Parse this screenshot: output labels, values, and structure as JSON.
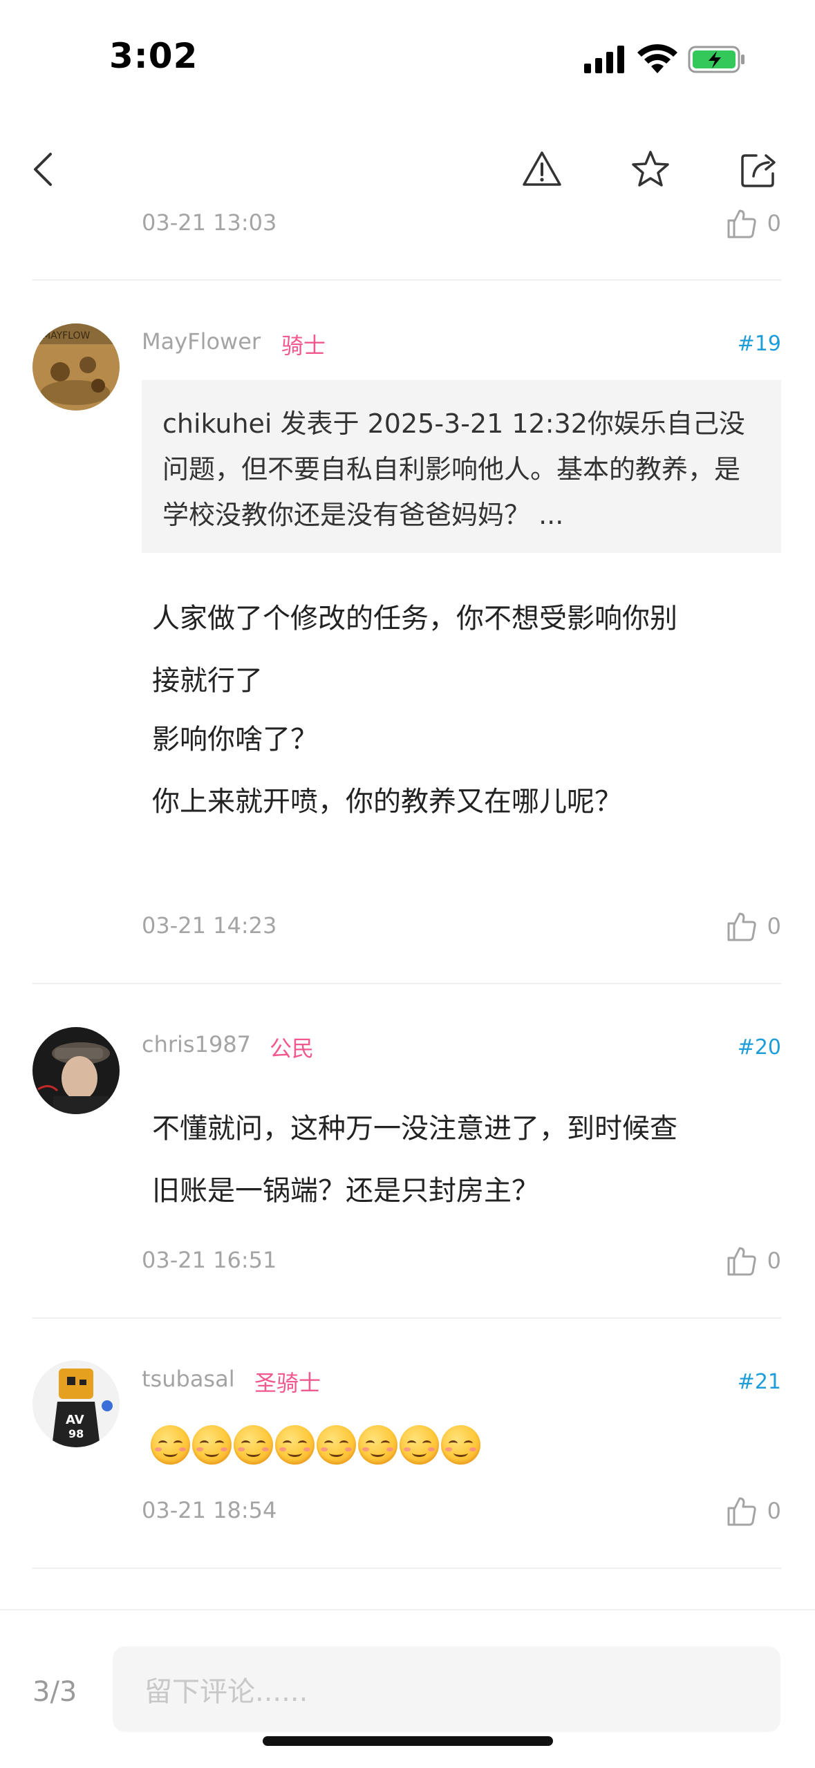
{
  "status_bar": {
    "time": "3:02"
  },
  "pagination": {
    "label": "3/3"
  },
  "comment_input": {
    "placeholder": "留下评论......"
  },
  "comments": [
    {
      "date": "03-21 13:03",
      "likes": "0"
    },
    {
      "username": "MayFlower",
      "rank": "骑士",
      "floor": "#19",
      "quote": "chikuhei 发表于 2025-3-21 12:32你娱乐自己没问题，但不要自私自利影响他人。基本的教养，是学校没教你还是没有爸爸妈妈？ ...",
      "lines": [
        "人家做了个修改的任务，你不想受影响你别",
        "接就行了",
        "影响你啥了？",
        "你上来就开喷，你的教养又在哪儿呢？"
      ],
      "date": "03-21 14:23",
      "likes": "0"
    },
    {
      "username": "chris1987",
      "rank": "公民",
      "floor": "#20",
      "lines": [
        "不懂就问，这种万一没注意进了，到时候查",
        "旧账是一锅端？还是只封房主？"
      ],
      "date": "03-21 16:51",
      "likes": "0"
    },
    {
      "username": "tsubasal",
      "rank": "圣骑士",
      "floor": "#21",
      "emoji_count": 8,
      "emoji_name": "relieved-face-emoji",
      "date": "03-21 18:54",
      "likes": "0"
    }
  ],
  "colors": {
    "rank": "#f0588f",
    "floor": "#1e9ed8",
    "meta": "#a4a4a4"
  }
}
